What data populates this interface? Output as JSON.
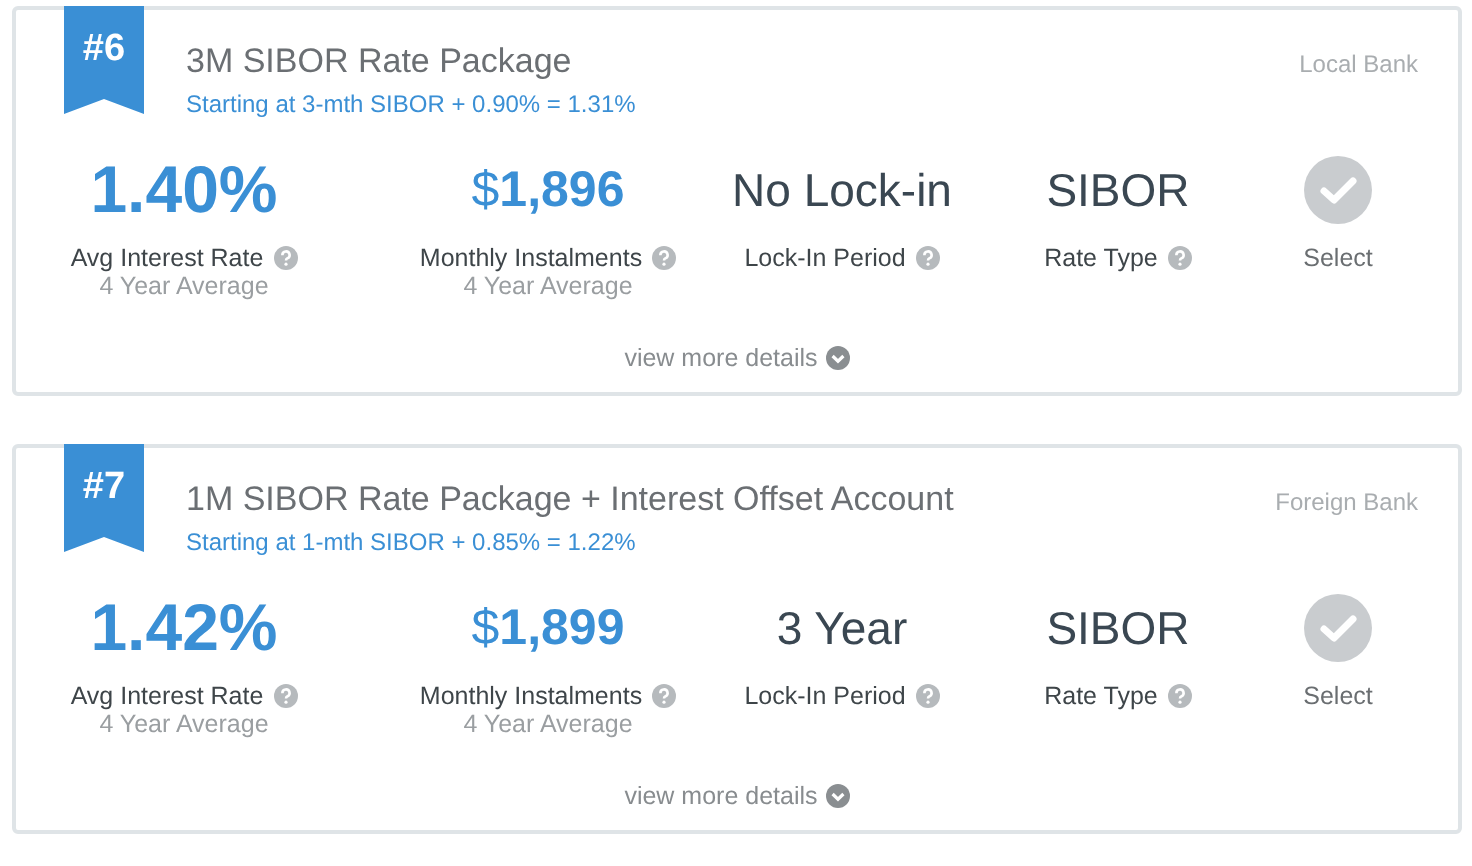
{
  "packages": [
    {
      "rank": "#6",
      "title": "3M SIBOR Rate Package",
      "subtitle": "Starting at 3-mth SIBOR + 0.90% = 1.31%",
      "bank": "Local Bank",
      "stats": [
        {
          "kind": "rate",
          "value": "1.40%",
          "label": "Avg Interest Rate",
          "note": "4 Year Average"
        },
        {
          "kind": "money",
          "value": "$**1,896**",
          "label": "Monthly Instalments",
          "note": "4 Year Average"
        },
        {
          "kind": "plain",
          "value": "No Lock-in",
          "label": "Lock-In Period"
        },
        {
          "kind": "plain",
          "value": "SIBOR",
          "label": "Rate Type"
        }
      ],
      "select": {
        "label": "Select",
        "selected": false
      },
      "details_link": "view more details"
    },
    {
      "rank": "#7",
      "title": "1M SIBOR Rate Package + Interest Offset Account",
      "subtitle": "Starting at 1-mth SIBOR + 0.85% = 1.22%",
      "bank": "Foreign Bank",
      "stats": [
        {
          "kind": "rate",
          "value": "1.42%",
          "label": "Avg Interest Rate",
          "note": "4 Year Average"
        },
        {
          "kind": "money",
          "value": "$**1,899**",
          "label": "Monthly Instalments",
          "note": "4 Year Average"
        },
        {
          "kind": "plain",
          "value": "3 Year",
          "label": "Lock-In Period"
        },
        {
          "kind": "plain",
          "value": "SIBOR",
          "label": "Rate Type"
        }
      ],
      "select": {
        "label": "Select",
        "selected": false
      },
      "details_link": "view more details"
    }
  ]
}
